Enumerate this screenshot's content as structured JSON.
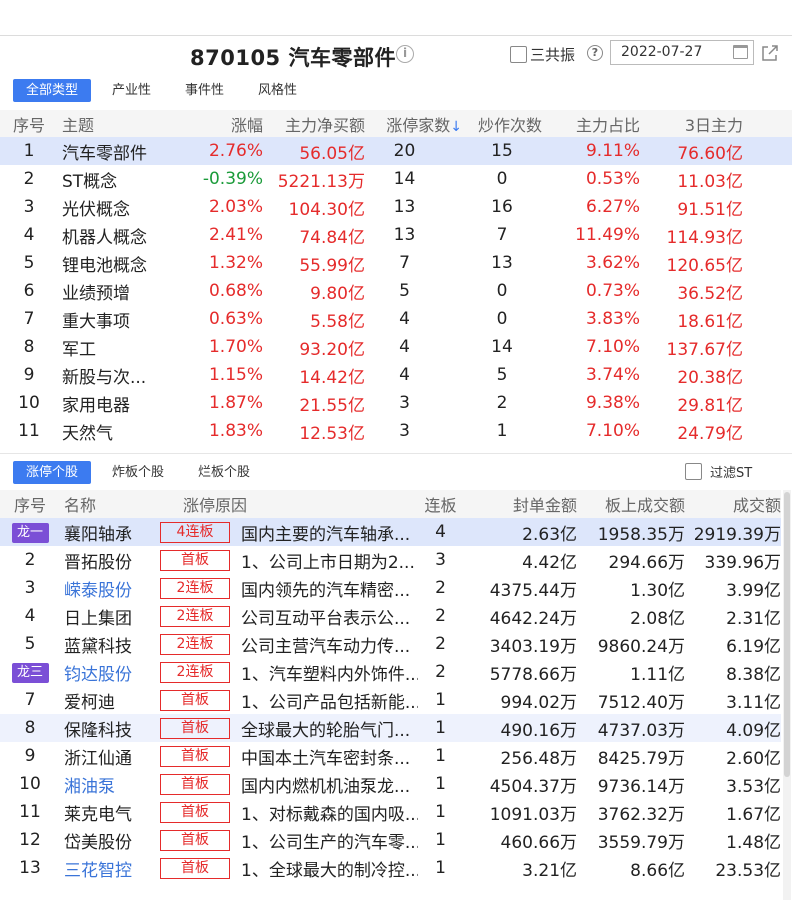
{
  "header": {
    "title": "870105 汽车零部件",
    "checkbox_label": "三共振",
    "date_value": "2022-07-27"
  },
  "tabs_top": [
    "全部类型",
    "产业性",
    "事件性",
    "风格性"
  ],
  "topics": {
    "columns": [
      "序号",
      "主题",
      "涨幅",
      "主力净买额",
      "涨停家数",
      "炒作次数",
      "主力占比",
      "3日主力"
    ],
    "sort_indicator": "↓",
    "rows": [
      [
        "1",
        "汽车零部件",
        "2.76%",
        "56.05亿",
        "20",
        "15",
        "9.11%",
        "76.60亿"
      ],
      [
        "2",
        "ST概念",
        "-0.39%",
        "5221.13万",
        "14",
        "0",
        "0.53%",
        "11.03亿"
      ],
      [
        "3",
        "光伏概念",
        "2.03%",
        "104.30亿",
        "13",
        "16",
        "6.27%",
        "91.51亿"
      ],
      [
        "4",
        "机器人概念",
        "2.41%",
        "74.84亿",
        "13",
        "7",
        "11.49%",
        "114.93亿"
      ],
      [
        "5",
        "锂电池概念",
        "1.32%",
        "55.99亿",
        "7",
        "13",
        "3.62%",
        "120.65亿"
      ],
      [
        "6",
        "业绩预增",
        "0.68%",
        "9.80亿",
        "5",
        "0",
        "0.73%",
        "36.52亿"
      ],
      [
        "7",
        "重大事项",
        "0.63%",
        "5.58亿",
        "4",
        "0",
        "3.83%",
        "18.61亿"
      ],
      [
        "8",
        "军工",
        "1.70%",
        "93.20亿",
        "4",
        "14",
        "7.10%",
        "137.67亿"
      ],
      [
        "9",
        "新股与次...",
        "1.15%",
        "14.42亿",
        "4",
        "5",
        "3.74%",
        "20.38亿"
      ],
      [
        "10",
        "家用电器",
        "1.87%",
        "21.55亿",
        "3",
        "2",
        "9.38%",
        "29.81亿"
      ],
      [
        "11",
        "天然气",
        "1.83%",
        "12.53亿",
        "3",
        "1",
        "7.10%",
        "24.79亿"
      ]
    ]
  },
  "tabs_bottom": [
    "涨停个股",
    "炸板个股",
    "烂板个股"
  ],
  "filter_label": "过滤ST",
  "stocks": {
    "columns": [
      "序号",
      "名称",
      "涨停原因",
      "连板",
      "封单金额",
      "板上成交额",
      "成交额"
    ],
    "rows": [
      {
        "idx": "龙一",
        "dragon": true,
        "name": "襄阳轴承",
        "blue": false,
        "badge": "4连板",
        "reason": "国内主要的汽车轴承...",
        "boards": "4",
        "seal": "2.63亿",
        "onboard": "1958.35万",
        "turnover": "2919.39万"
      },
      {
        "idx": "2",
        "dragon": false,
        "name": "晋拓股份",
        "blue": false,
        "badge": "首板",
        "reason": "1、公司上市日期为2...",
        "boards": "3",
        "seal": "4.42亿",
        "onboard": "294.66万",
        "turnover": "339.96万"
      },
      {
        "idx": "3",
        "dragon": false,
        "name": "嵘泰股份",
        "blue": true,
        "badge": "2连板",
        "reason": "国内领先的汽车精密...",
        "boards": "2",
        "seal": "4375.44万",
        "onboard": "1.30亿",
        "turnover": "3.99亿"
      },
      {
        "idx": "4",
        "dragon": false,
        "name": "日上集团",
        "blue": false,
        "badge": "2连板",
        "reason": "公司互动平台表示公...",
        "boards": "2",
        "seal": "4642.24万",
        "onboard": "2.08亿",
        "turnover": "2.31亿"
      },
      {
        "idx": "5",
        "dragon": false,
        "name": "蓝黛科技",
        "blue": false,
        "badge": "2连板",
        "reason": "公司主营汽车动力传...",
        "boards": "2",
        "seal": "3403.19万",
        "onboard": "9860.24万",
        "turnover": "6.19亿"
      },
      {
        "idx": "龙三",
        "dragon": true,
        "name": "钧达股份",
        "blue": true,
        "badge": "2连板",
        "reason": "1、汽车塑料内外饰件...",
        "boards": "2",
        "seal": "5778.66万",
        "onboard": "1.11亿",
        "turnover": "8.38亿"
      },
      {
        "idx": "7",
        "dragon": false,
        "name": "爱柯迪",
        "blue": false,
        "badge": "首板",
        "reason": "1、公司产品包括新能...",
        "boards": "1",
        "seal": "994.02万",
        "onboard": "7512.40万",
        "turnover": "3.11亿"
      },
      {
        "idx": "8",
        "dragon": false,
        "name": "保隆科技",
        "blue": false,
        "badge": "首板",
        "reason": "全球最大的轮胎气门...",
        "boards": "1",
        "seal": "490.16万",
        "onboard": "4737.03万",
        "turnover": "4.09亿"
      },
      {
        "idx": "9",
        "dragon": false,
        "name": "浙江仙通",
        "blue": false,
        "badge": "首板",
        "reason": "中国本土汽车密封条...",
        "boards": "1",
        "seal": "256.48万",
        "onboard": "8425.79万",
        "turnover": "2.60亿"
      },
      {
        "idx": "10",
        "dragon": false,
        "name": "湘油泵",
        "blue": true,
        "badge": "首板",
        "reason": "国内内燃机机油泵龙...",
        "boards": "1",
        "seal": "4504.37万",
        "onboard": "9736.14万",
        "turnover": "3.53亿"
      },
      {
        "idx": "11",
        "dragon": false,
        "name": "莱克电气",
        "blue": false,
        "badge": "首板",
        "reason": "1、对标戴森的国内吸...",
        "boards": "1",
        "seal": "1091.03万",
        "onboard": "3762.32万",
        "turnover": "1.67亿"
      },
      {
        "idx": "12",
        "dragon": false,
        "name": "岱美股份",
        "blue": false,
        "badge": "首板",
        "reason": "1、公司生产的汽车零...",
        "boards": "1",
        "seal": "460.66万",
        "onboard": "3559.79万",
        "turnover": "1.48亿"
      },
      {
        "idx": "13",
        "dragon": false,
        "name": "三花智控",
        "blue": true,
        "badge": "首板",
        "reason": "1、全球最大的制冷控...",
        "boards": "1",
        "seal": "3.21亿",
        "onboard": "8.66亿",
        "turnover": "23.53亿"
      }
    ]
  },
  "colors": {
    "accent": "#3c7bf0",
    "up": "#e52b2b",
    "down": "#1b9b3a",
    "dragon": "#7b4fd6",
    "selected_row": "#dde6fb"
  }
}
